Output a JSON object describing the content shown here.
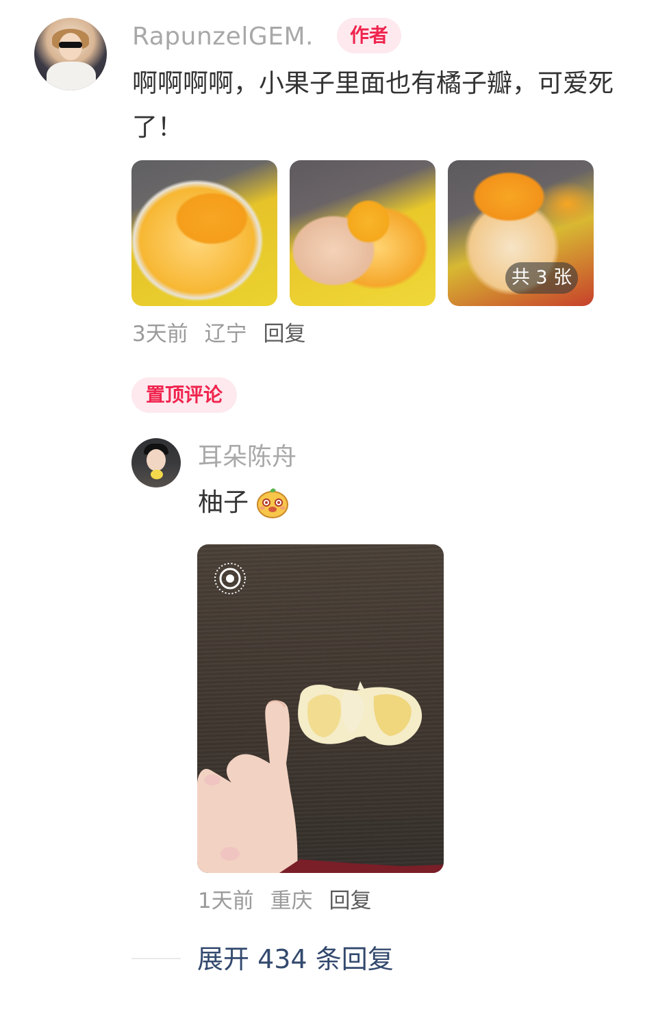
{
  "main_comment": {
    "username": "RapunzelGEM.",
    "author_badge": "作者",
    "text": "啊啊啊啊，小果子里面也有橘子瓣，可爱死了！",
    "photo_count_label": "共 3 张",
    "meta": {
      "time": "3天前",
      "location": "辽宁",
      "reply": "回复"
    }
  },
  "pinned_label": "置顶评论",
  "sub_comment": {
    "username": "耳朵陈舟",
    "text": "柚子",
    "meta": {
      "time": "1天前",
      "location": "重庆",
      "reply": "回复"
    }
  },
  "expand_replies": "展开 434 条回复",
  "colors": {
    "accent_red": "#f0244e",
    "badge_bg": "#fde9ee",
    "link_blue": "#33496e",
    "meta_gray": "#9a9a9a",
    "name_gray": "#a8a8a8",
    "text_dark": "#333333"
  },
  "icons": {
    "live_photo": "live-photo-icon",
    "sticker": "smiling-fruit-sticker-icon"
  }
}
